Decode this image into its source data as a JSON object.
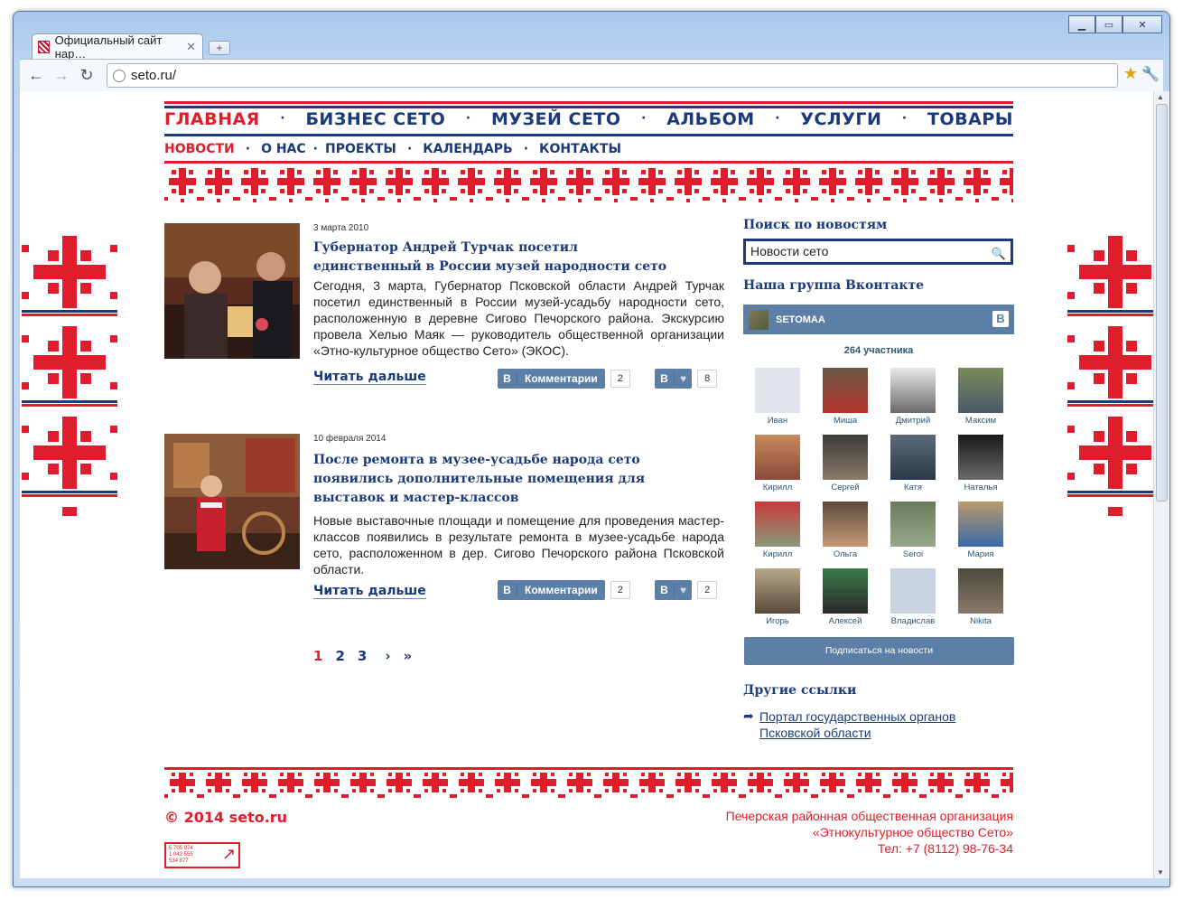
{
  "browser": {
    "tab_title": "Официальный сайт нар…",
    "url": "seto.ru/",
    "tab_close": "✕",
    "new_tab": "+",
    "back": "←",
    "forward": "→",
    "reload": "↻",
    "star": "★",
    "wrench": "🔧",
    "window_controls": {
      "minimize": "▁",
      "maximize": "▭",
      "close": "✕"
    }
  },
  "menu_main": {
    "items": [
      "ГЛАВНАЯ",
      "БИЗНЕС СЕТО",
      "МУЗЕЙ СЕТО",
      "АЛЬБОМ",
      "УСЛУГИ",
      "ТОВАРЫ"
    ],
    "separator": "·",
    "active": "ГЛАВНАЯ"
  },
  "menu_sub": {
    "items": [
      "НОВОСТИ",
      "О НАС",
      "ПРОЕКТЫ",
      "КАЛЕНДАРЬ",
      "КОНТАКТЫ"
    ],
    "separator": "·",
    "active": "НОВОСТИ"
  },
  "news": [
    {
      "date": "3 марта 2010",
      "title": "Губернатор Андрей Турчак посетил единственный в России музей народности сето",
      "text": "Сегодня, 3 марта, Губернатор Псковской области Андрей Турчак посетил единственный в России музей-усадьбу народности сето, расположенную в деревне Сигово Печорского района. Экскурсию провела Хелью Маяк — руководитель общественной организации «Этно-культурное общество Сето» (ЭКОС).",
      "more": "Читать дальше",
      "vk_b": "В",
      "comments_label": "Комментарии",
      "comments_count": "2",
      "likes_count": "8",
      "heart": "♥"
    },
    {
      "date": "10 февраля 2014",
      "title": "После ремонта в музее-усадьбе народа сето появились дополнительные помещения для выставок и мастер-классов",
      "text": "Новые выставочные площади и помещение для проведения мастер-классов появились в результате ремонта в музее-усадьбе народа сето, расположенном в дер. Сигово Печорского района Псковской области.",
      "more": "Читать дальше",
      "vk_b": "В",
      "comments_label": "Комментарии",
      "comments_count": "2",
      "likes_count": "2",
      "heart": "♥"
    }
  ],
  "pagination": {
    "pages": [
      "1",
      "2",
      "3"
    ],
    "current": "1",
    "next": "›",
    "last": "»"
  },
  "sidebar": {
    "search_title": "Поиск по новостям",
    "search_value": "Новости сето",
    "search_icon": "🔍",
    "vk_title": "Наша группа Вконтакте",
    "vk_group_name": "SETOMAA",
    "vk_logo": "B",
    "members_count": "264 участника",
    "members": [
      "Иван",
      "Миша",
      "Дмитрий",
      "Максим",
      "Кирилл",
      "Сергей",
      "Катя",
      "Наталья",
      "Кирилл",
      "Ольга",
      "Seroi",
      "Мария",
      "Игорь",
      "Алексей",
      "Владислав",
      "Nikita"
    ],
    "subscribe": "Подписаться на новости",
    "links_title": "Другие ссылки",
    "links": [
      "Портал государственных органов Псковской области"
    ],
    "link_arrow": "➦"
  },
  "footer": {
    "copyright": "© 2014 seto.ru",
    "org_lines": [
      "Печерская районная общественная  организация",
      "«Этнокультурное общество Сето»",
      "Тел: +7 (8112) 98-76-34"
    ],
    "counter_lines": [
      "5 705 974",
      "1 042 555",
      "534 877"
    ]
  },
  "colors": {
    "brand_blue": "#1b3a7a",
    "brand_red": "#e01d2c",
    "vk_blue": "#5b7fa6"
  }
}
